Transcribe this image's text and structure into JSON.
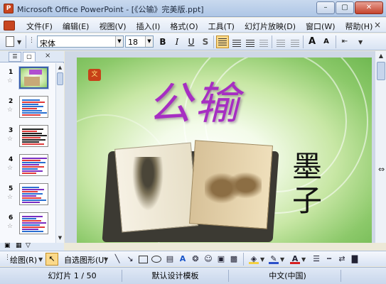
{
  "window": {
    "title": "Microsoft Office PowerPoint - [《公输》完美版.ppt]",
    "min_label": "–",
    "max_label": "▢",
    "close_label": "✕"
  },
  "menu": {
    "items": [
      "文件(F)",
      "编辑(E)",
      "视图(V)",
      "插入(I)",
      "格式(O)",
      "工具(T)",
      "幻灯片放映(D)",
      "窗口(W)",
      "帮助(H)"
    ],
    "close_doc": "×"
  },
  "toolbar": {
    "font_name": "宋体",
    "font_size": "18",
    "bold": "B",
    "italic": "I",
    "underline": "U",
    "shadow": "S",
    "grow_font": "A",
    "shrink_font": "A"
  },
  "outline_pane": {
    "tab_outline": "☰",
    "tab_slides": "▢",
    "close": "×",
    "slides": [
      {
        "number": "1",
        "selected": true
      },
      {
        "number": "2",
        "selected": false
      },
      {
        "number": "3",
        "selected": false
      },
      {
        "number": "4",
        "selected": false
      },
      {
        "number": "5",
        "selected": false
      },
      {
        "number": "6",
        "selected": false
      }
    ],
    "star": "☆"
  },
  "slide": {
    "title": "公输",
    "author": "墨子",
    "logo_text": "文"
  },
  "drawing_toolbar": {
    "draw_label": "绘图(R)",
    "autoshapes_label": "自选图形(U)",
    "pointer_icon": "cursor-arrow",
    "line_icon": "line",
    "arrow_icon": "arrow",
    "rectangle_icon": "rectangle",
    "oval_icon": "oval",
    "textbox_icon": "text-box",
    "wordart_icon": "wordart",
    "fill_color": "#f4d03f",
    "line_color": "#2b50c8",
    "font_color": "#d61f1f"
  },
  "status_bar": {
    "slide_info": "幻灯片 1 / 50",
    "template": "默认设计模板",
    "language": "中文(中国)"
  }
}
